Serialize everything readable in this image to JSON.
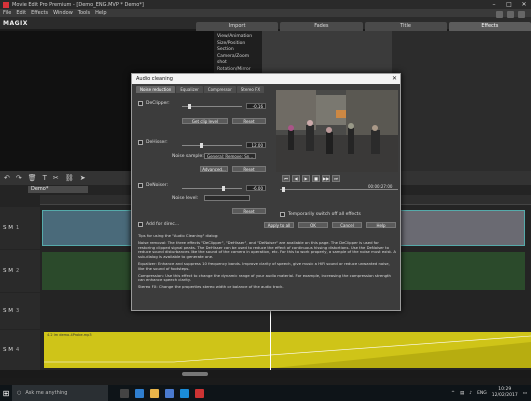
{
  "window": {
    "title": "Movie Edit Pro Premium - [Demo_ENG.MVP * Demo*]",
    "minimize": "–",
    "maximize": "□",
    "close": "✕"
  },
  "menu": [
    "File",
    "Edit",
    "Effects",
    "Window",
    "Tools",
    "Help"
  ],
  "brand": "MAGIX",
  "tabs": [
    "Import",
    "Fades",
    "Title",
    "Effects"
  ],
  "effects_tree": [
    "View/Animation",
    "Size/Position",
    "Section",
    "Camera/Zoom shot",
    "Rotation/Mirror"
  ],
  "project_tab": "Demo*",
  "tracks": [
    {
      "label": "S M",
      "num": "1"
    },
    {
      "label": "S M",
      "num": "2"
    },
    {
      "label": "S M",
      "num": "3"
    },
    {
      "label": "S M",
      "num": "4"
    }
  ],
  "yellow_clip_label": "4.2 Im demo-4Probe.mp3",
  "dialog": {
    "title": "Audio cleaning",
    "tabs": [
      "Noise reduction",
      "Equalizer",
      "Compressor",
      "Stereo FX"
    ],
    "sections": {
      "declipper": {
        "label": "DeClipper:",
        "value": "-0.16",
        "button1": "Get clip level",
        "button2": "Reset"
      },
      "dehisser": {
        "label": "DeHisser:",
        "value": "12.00",
        "noise_sample_label": "Noise sample:",
        "noise_sample_value": "General: Remove: Sn...",
        "button1": "Advanced...",
        "button2": "Reset"
      },
      "denoiser": {
        "label": "DeNoiser:",
        "value": "-6.00",
        "noise_level_label": "Noise level:",
        "button": "Reset"
      }
    },
    "timecode": "00:00:27:00",
    "temporarily_switch": "Temporarily switch off all effects",
    "add_label": "Add for direc...",
    "buttons": [
      "Apply to all",
      "OK",
      "Cancel",
      "Help"
    ],
    "description": [
      "Tips for using the \"Audio Cleaning\" dialog:",
      "Noise removal: The three effects \"DeClipper\", \"DeHisser\", and \"DeNoiser\" are available on this page. The DeClipper is used for restoring clipped signal peaks. The DeHisser can be used to reduce the effect of continuous hissing distortions. Use the DeNoiser to reduce sound disturbances like the sound of the camera in operation, etc. For this to work properly, a sample of the noise must exist. A sub-dialog is available to generate one.",
      "Equalizer: Enhance and suppress 10 frequency bands. Improve clarity of speech, give music a HiFi sound or reduce unwanted noise, like the sound of footsteps.",
      "Compression: Use this effect to change the dynamic range of your audio material. For example, increasing the compression strength can enhance speech clarity.",
      "Stereo FX: Change the properties stereo width or balance of the audio track."
    ]
  },
  "taskbar": {
    "search_placeholder": "Ask me anything",
    "lang": "ENG",
    "time": "10:29",
    "date": "12/02/2017"
  },
  "colors": {
    "accent": "#2f7fd0",
    "yellow": "#cfc418",
    "audio_green": "#2b4a2b"
  }
}
